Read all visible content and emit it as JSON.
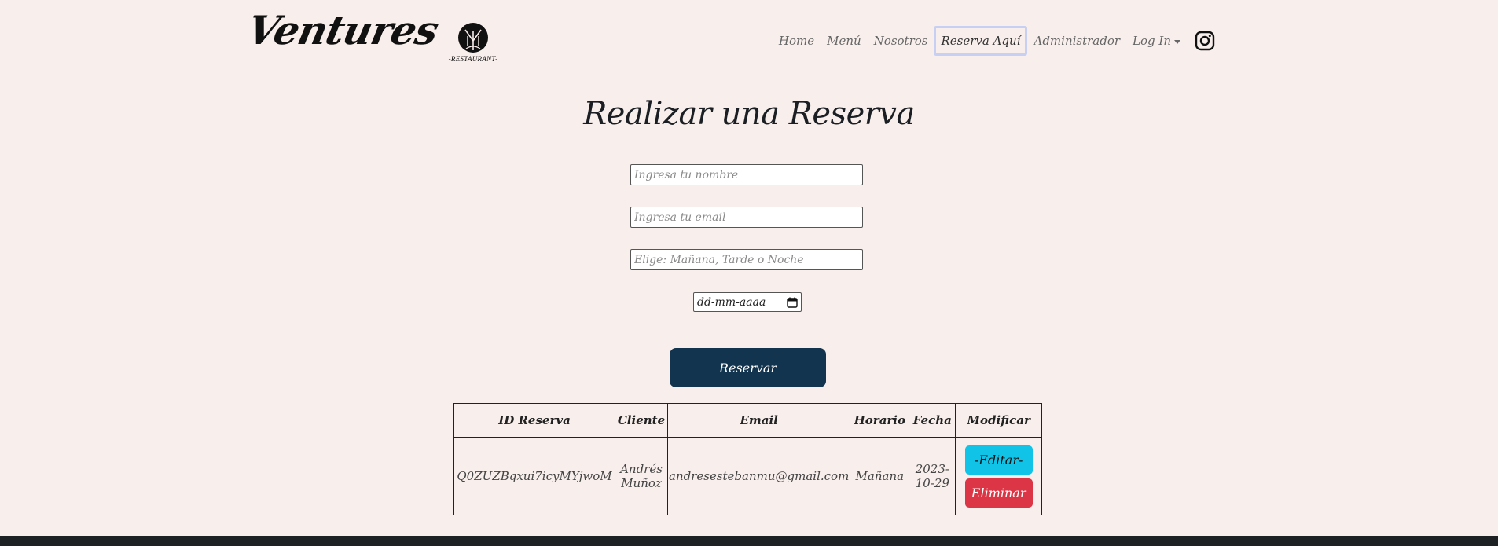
{
  "brand": {
    "name": "Ventures",
    "logo_caption": "-RESTAURANT-"
  },
  "nav": {
    "items": [
      {
        "label": "Home"
      },
      {
        "label": "Menú"
      },
      {
        "label": "Nosotros"
      },
      {
        "label": "Reserva Aquí",
        "active": true
      },
      {
        "label": "Administrador"
      },
      {
        "label": "Log In"
      }
    ],
    "social_icon": "instagram-icon"
  },
  "page": {
    "title": "Realizar una Reserva"
  },
  "form": {
    "name_placeholder": "Ingresa tu nombre",
    "email_placeholder": "Ingresa tu email",
    "schedule_placeholder": "Elige: Mañana, Tarde o Noche",
    "date_placeholder": "dd-mm-aaaa",
    "submit_label": "Reservar"
  },
  "table": {
    "headers": [
      "ID Reserva",
      "Cliente",
      "Email",
      "Horario",
      "Fecha",
      "Modificar"
    ],
    "rows": [
      {
        "id": "Q0ZUZBqxui7icyMYjwoM",
        "client": "Andrés Muñoz",
        "email": "andresestebanmu@gmail.com",
        "schedule": "Mañana",
        "date": "2023-10-29",
        "edit_label": "-Editar-",
        "delete_label": "Eliminar"
      }
    ]
  },
  "colors": {
    "background": "#f8efec",
    "primary_button": "#12344f",
    "edit_button": "#12c3e8",
    "delete_button": "#dc3545",
    "footer": "#1e2124"
  }
}
